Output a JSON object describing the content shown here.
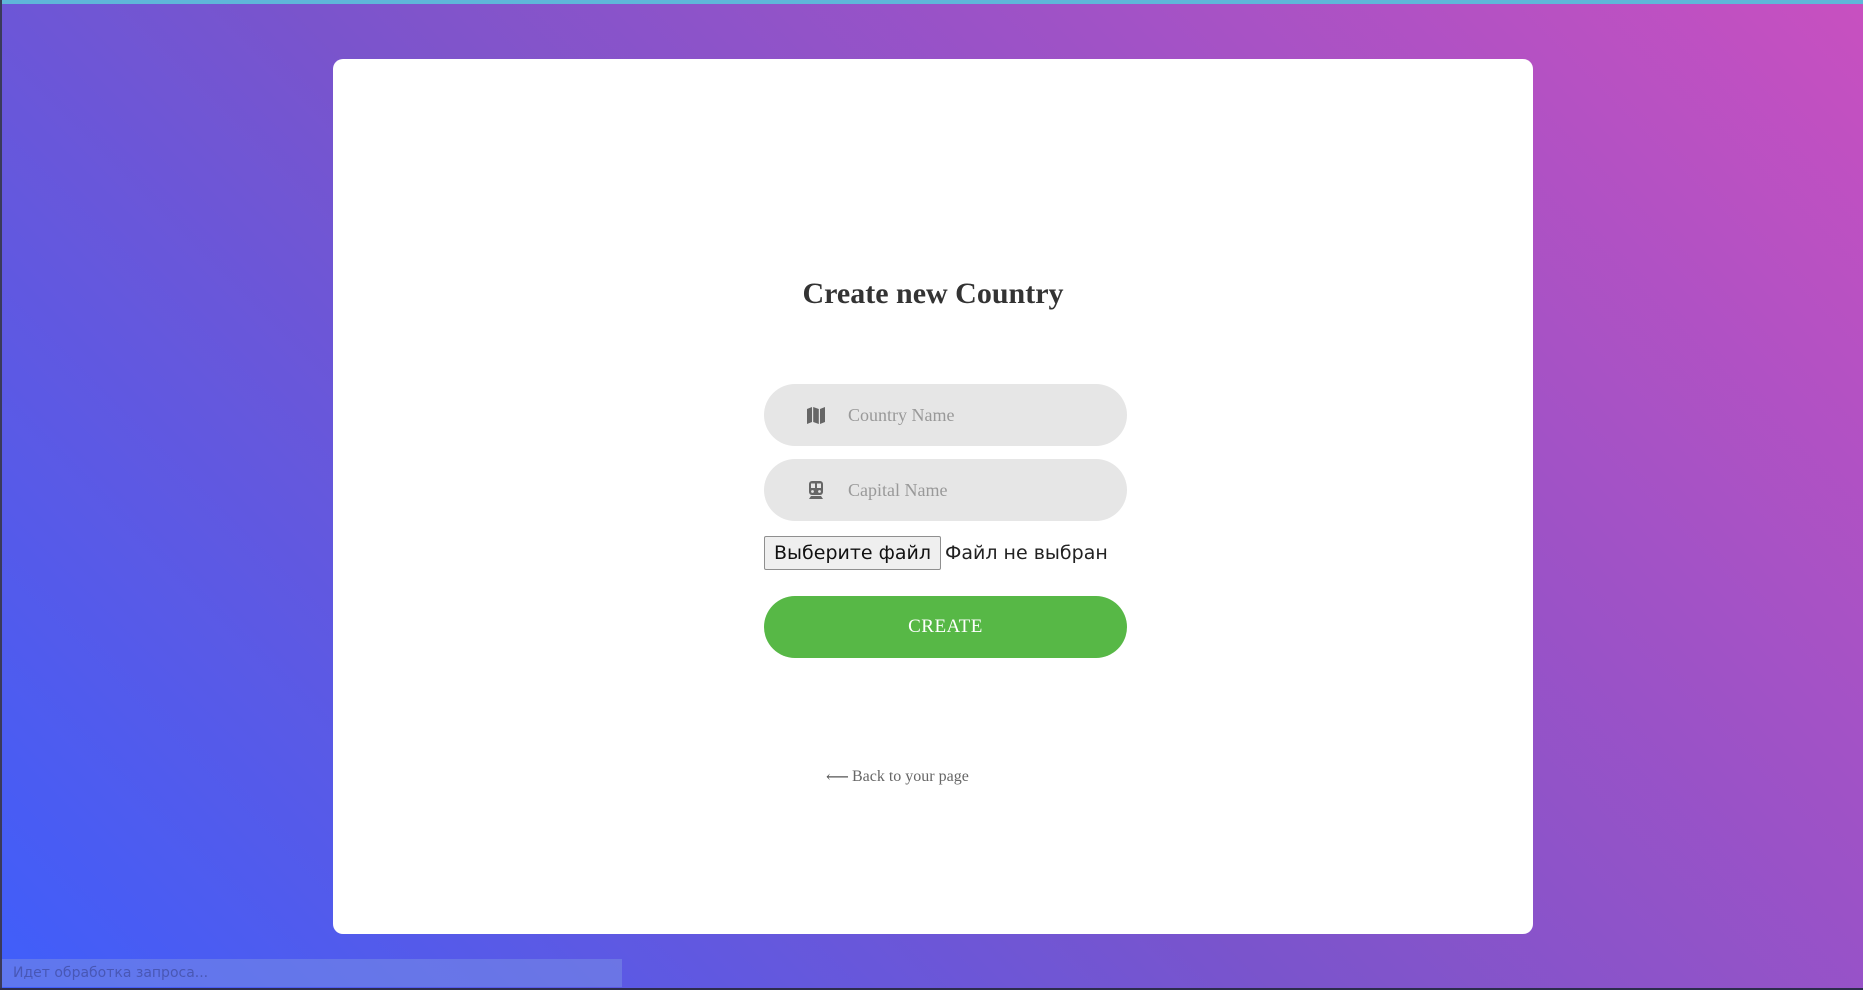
{
  "form": {
    "title": "Create new Country",
    "country_field": {
      "placeholder": "Country Name",
      "icon": "map-icon"
    },
    "capital_field": {
      "placeholder": "Capital Name",
      "icon": "train-icon"
    },
    "file_input": {
      "button_label": "Выберите файл",
      "status": "Файл не выбран"
    },
    "submit_label": "CREATE",
    "back_link": {
      "arrow": "⟵",
      "label": "Back to your page"
    }
  },
  "browser": {
    "status_text": "Идет обработка запроса..."
  },
  "colors": {
    "gradient_start": "#3f5efb",
    "gradient_end": "#c850c0",
    "card_background": "#ffffff",
    "field_background": "#e6e6e6",
    "button_green": "#57b846"
  }
}
